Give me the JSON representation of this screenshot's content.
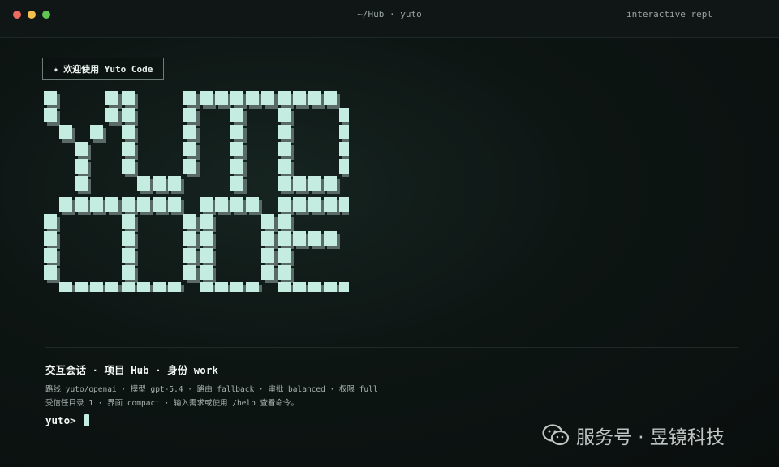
{
  "window": {
    "title": "~/Hub · yuto",
    "mode": "interactive repl"
  },
  "badge": {
    "icon": "sparkle-icon",
    "text": "欢迎使用 Yuto Code"
  },
  "logo": {
    "lines": [
      "YUTO",
      "CODE"
    ],
    "color": "#c4ece0",
    "shadow_color": "#5a6b67"
  },
  "session": {
    "line": "交互会话 · 项目 Hub · 身份 work"
  },
  "info": {
    "line1": "路线 yuto/openai · 模型 gpt-5.4 · 路由 fallback · 审批 balanced · 权限 full",
    "line2": "受信任目录 1 · 界面 compact · 输入需求或使用 /help 查看命令。"
  },
  "prompt": {
    "text": "yuto>"
  },
  "watermark": {
    "icon": "wechat-icon",
    "text": "服务号 · 昱镜科技"
  },
  "colors": {
    "background": "#0d1513",
    "accent": "#c4ece0",
    "traffic_red": "#ec6a5e",
    "traffic_yellow": "#f4bf4f",
    "traffic_green": "#61c554"
  }
}
